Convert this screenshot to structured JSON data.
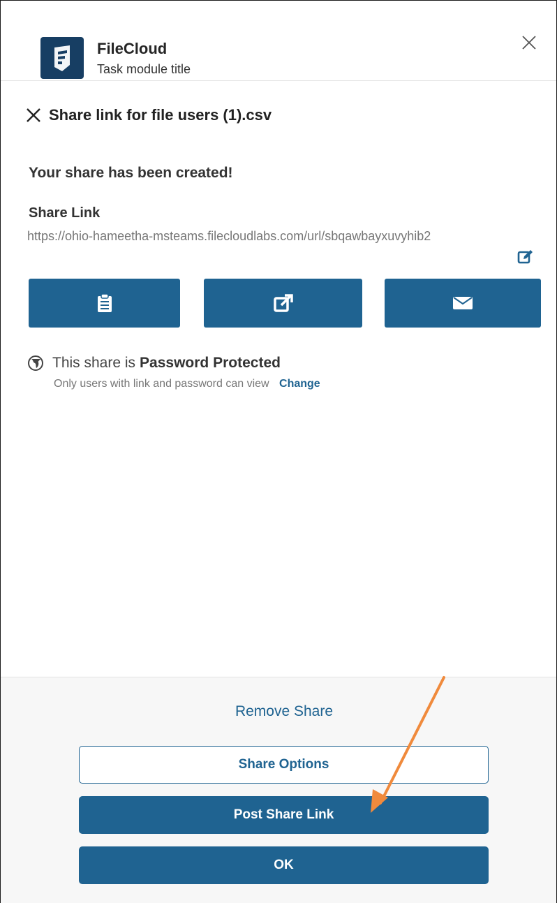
{
  "header": {
    "app_name": "FileCloud",
    "subtitle": "Task module title",
    "logo_icon": "filecloud-logo",
    "close_icon": "close-icon"
  },
  "dialog": {
    "title": "Share link for file users (1).csv",
    "created_message": "Your share has been created!",
    "share_link_label": "Share Link",
    "share_url": "https://ohio-hameetha-msteams.filecloudlabs.com/url/sbqawbayxuvyhib2",
    "edit_icon": "edit-icon",
    "actions": [
      {
        "icon": "clipboard-icon"
      },
      {
        "icon": "open-link-icon"
      },
      {
        "icon": "envelope-icon"
      }
    ],
    "protection": {
      "prefix": "This share is",
      "status": "Password Protected",
      "note": "Only users with link and password can view",
      "change_label": "Change"
    }
  },
  "footer": {
    "remove_share": "Remove Share",
    "share_options": "Share Options",
    "post_share_link": "Post Share Link",
    "ok": "OK"
  },
  "colors": {
    "brand": "#1f6391",
    "logo_bg": "#173e63",
    "annotation_arrow": "#f08a3c"
  }
}
